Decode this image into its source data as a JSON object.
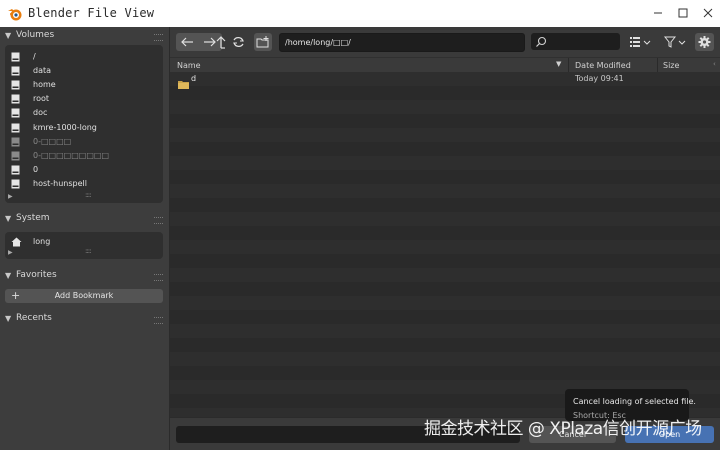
{
  "window": {
    "title": "Blender File View"
  },
  "sidebar": {
    "volumes": {
      "header": "Volumes",
      "items": [
        {
          "label": "/",
          "dim": false
        },
        {
          "label": "data",
          "dim": false
        },
        {
          "label": "home",
          "dim": false
        },
        {
          "label": "root",
          "dim": false
        },
        {
          "label": "doc",
          "dim": false
        },
        {
          "label": "kmre-1000-long",
          "dim": false
        },
        {
          "label": "0-□□□□",
          "dim": true
        },
        {
          "label": "0-□□□□□□□□□",
          "dim": true
        },
        {
          "label": "0",
          "dim": false
        },
        {
          "label": "host-hunspell",
          "dim": false
        }
      ]
    },
    "system": {
      "header": "System",
      "items": [
        {
          "label": "long"
        }
      ]
    },
    "favorites": {
      "header": "Favorites",
      "add_bookmark": "Add Bookmark"
    },
    "recents": {
      "header": "Recents"
    }
  },
  "toolbar": {
    "path": "/home/long/□□/"
  },
  "columns": {
    "name": "Name",
    "date": "Date Modified",
    "size": "Size"
  },
  "files": [
    {
      "name": "d",
      "date": "Today 09:41",
      "type": "folder"
    }
  ],
  "bottom": {
    "cancel": "Cancel",
    "open": "Open"
  },
  "tooltip": {
    "line1": "Cancel loading of selected file.",
    "line2": "Shortcut: Esc"
  },
  "watermark": "掘金技术社区 @ XPlaza信创开源广场",
  "colors": {
    "accent": "#4772b3",
    "panel": "#3d3d3d",
    "background": "#2b2b2b"
  }
}
